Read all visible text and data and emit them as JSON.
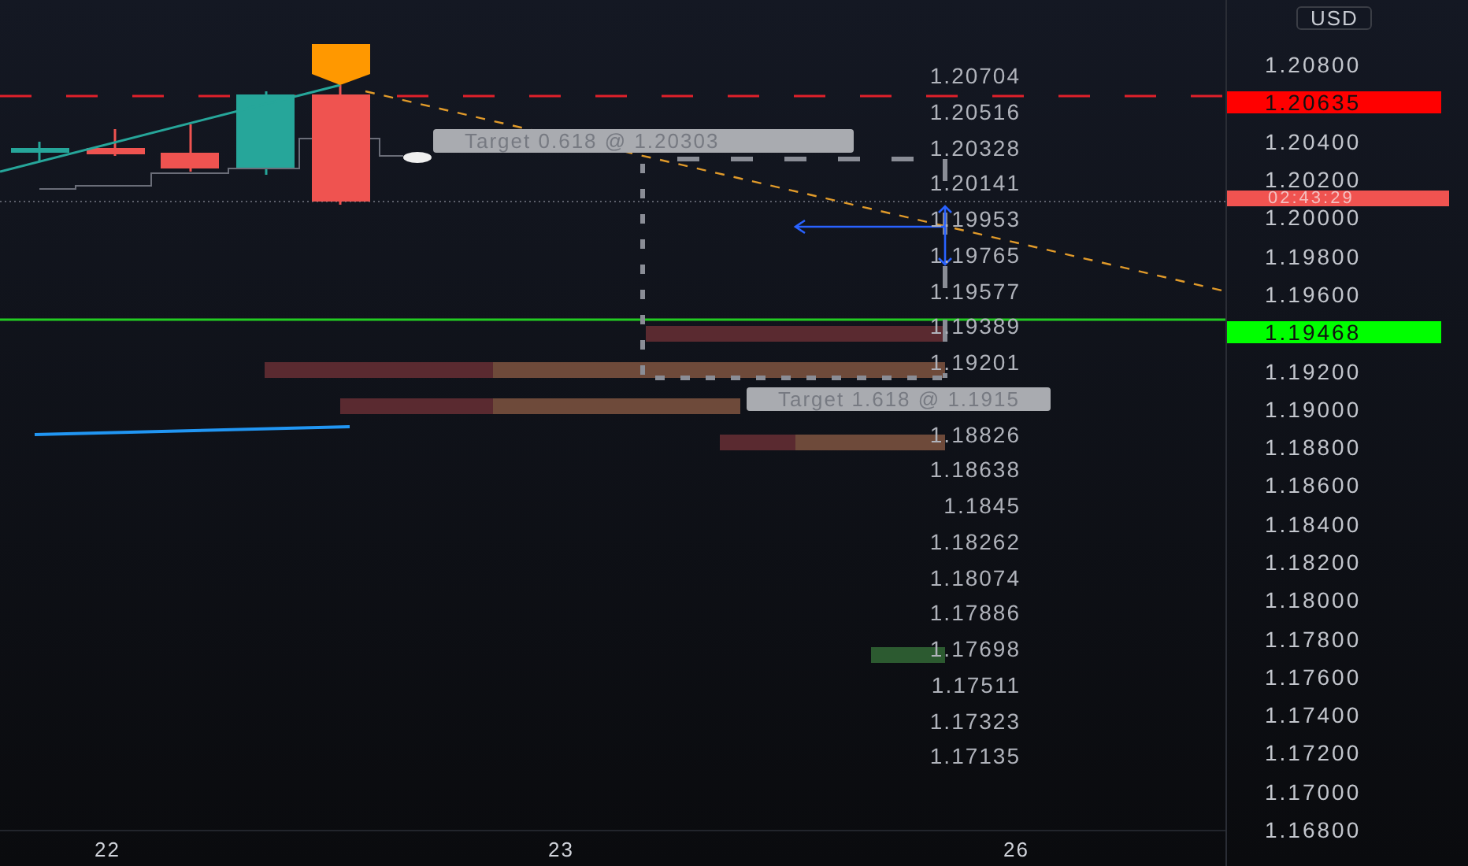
{
  "currency": "USD",
  "price_axis": [
    {
      "kind": "tick",
      "text": "1.20800"
    },
    {
      "kind": "price",
      "text": "1.20635",
      "color": "#ff0000"
    },
    {
      "kind": "tick",
      "text": "1.20400"
    },
    {
      "kind": "tick",
      "text": "1.20200"
    },
    {
      "kind": "tick",
      "text": "1.20000"
    },
    {
      "kind": "tick",
      "text": "1.19800"
    },
    {
      "kind": "tick",
      "text": "1.19600"
    },
    {
      "kind": "price",
      "text": "1.19468",
      "color": "#00ff00"
    },
    {
      "kind": "tick",
      "text": "1.19200"
    },
    {
      "kind": "tick",
      "text": "1.19000"
    },
    {
      "kind": "tick",
      "text": "1.18800"
    },
    {
      "kind": "tick",
      "text": "1.18600"
    },
    {
      "kind": "tick",
      "text": "1.18400"
    },
    {
      "kind": "tick",
      "text": "1.18200"
    },
    {
      "kind": "tick",
      "text": "1.18000"
    },
    {
      "kind": "tick",
      "text": "1.17800"
    },
    {
      "kind": "tick",
      "text": "1.17600"
    },
    {
      "kind": "tick",
      "text": "1.17400"
    },
    {
      "kind": "tick",
      "text": "1.17200"
    },
    {
      "kind": "tick",
      "text": "1.17000"
    },
    {
      "kind": "tick",
      "text": "1.16800"
    }
  ],
  "countdown": {
    "text": "02:43:29",
    "color": "#f05350"
  },
  "level_labels": [
    "1.20704",
    "1.20516",
    "1.20328",
    "1.20141",
    "1.19953",
    "1.19765",
    "1.19577",
    "1.19389",
    "1.19201",
    "1.18826",
    "1.18638",
    "1.1845",
    "1.18262",
    "1.18074",
    "1.17886",
    "1.17698",
    "1.17511",
    "1.17323",
    "1.17135"
  ],
  "targets": [
    "Target 0.618 @ 1.20303",
    "Target 1.618 @ 1.1915"
  ],
  "time_axis": [
    "22",
    "23",
    "26"
  ]
}
